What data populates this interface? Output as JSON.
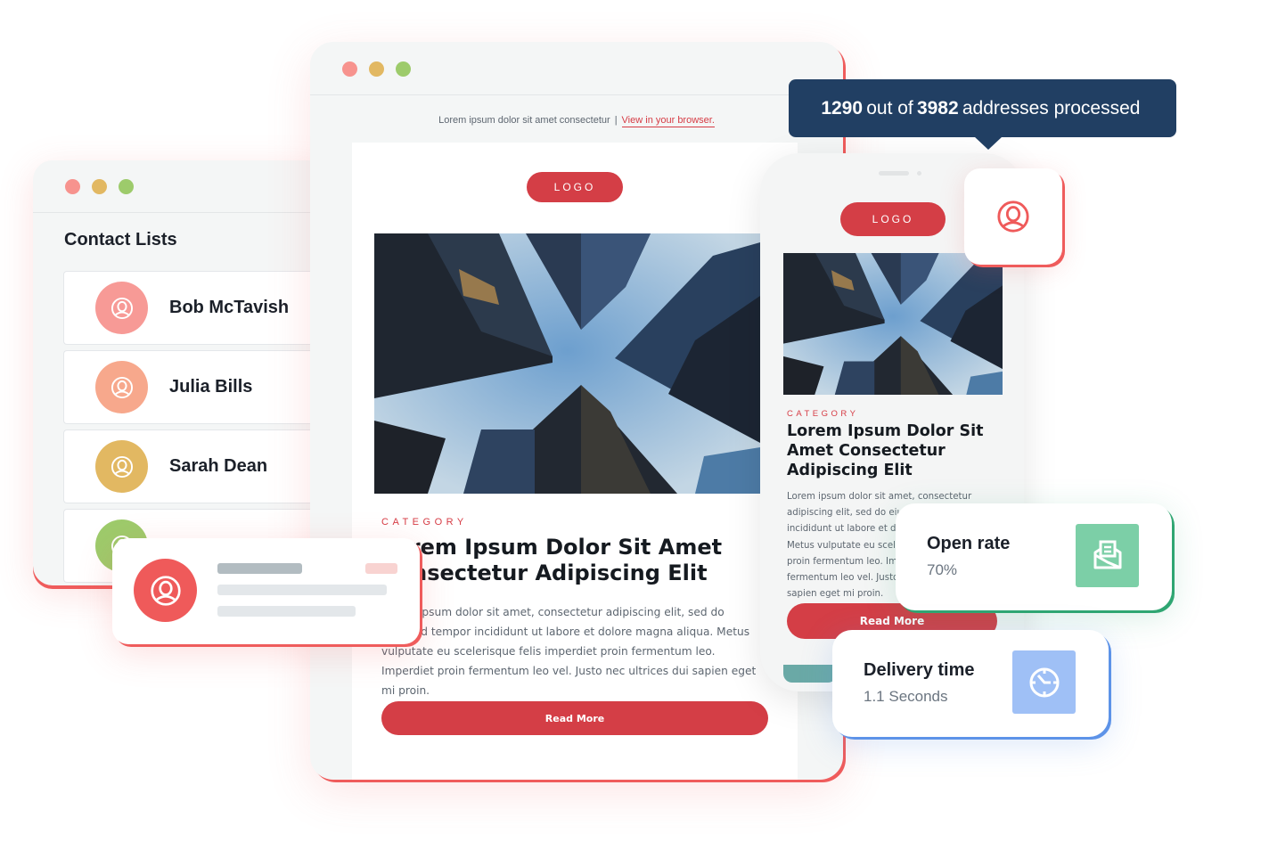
{
  "colors": {
    "accent_red": "#d43e46",
    "tooltip_navy": "#213f63",
    "open_rate_green": "#7ccfa7",
    "delivery_blue": "#9fc0f6",
    "window_dot_red": "#f7938e",
    "window_dot_yellow": "#e2b862",
    "window_dot_green": "#9dcb6b"
  },
  "contacts_window": {
    "title": "Contact Lists",
    "contacts": [
      {
        "name": "Bob McTavish",
        "avatar_color": "#f79a96",
        "icon": "user-circle-icon"
      },
      {
        "name": "Julia Bills",
        "avatar_color": "#f7a88c",
        "icon": "user-circle-icon"
      },
      {
        "name": "Sarah Dean",
        "avatar_color": "#e2b862",
        "icon": "user-circle-icon"
      },
      {
        "name": "",
        "avatar_color": "#9dcb6b",
        "icon": "user-circle-icon"
      }
    ]
  },
  "email_window": {
    "preheader_text": "Lorem ipsum dolor sit amet consectetur",
    "preheader_separator": "|",
    "view_in_browser": "View in your browser.",
    "logo_label": "LOGO",
    "category": "CATEGORY",
    "headline": "Lorem Ipsum Dolor Sit Amet Consectetur Adipiscing Elit",
    "body": "Lorem ipsum dolor sit amet, consectetur adipiscing elit, sed do eiusmod tempor incididunt ut labore et dolore magna aliqua. Metus vulputate eu scelerisque felis imperdiet proin fermentum leo. Imperdiet proin fermentum leo vel. Justo nec ultrices dui sapien eget mi proin.",
    "read_more": "Read More",
    "hero_image": "city-skyscrapers-looking-up"
  },
  "phone": {
    "logo_label": "LOGO",
    "category": "CATEGORY",
    "headline": "Lorem Ipsum Dolor Sit Amet Consectetur Adipiscing Elit",
    "body": "Lorem ipsum dolor sit amet, consectetur adipiscing elit, sed do eiusmod tempor incididunt ut labore et dolore magna aliqua. Metus vulputate eu scelerisque felis imperdiet proin fermentum leo. Imperdiet proin fermentum leo vel. Justo nec ultrices dui sapien eget mi proin.",
    "read_more": "Read More",
    "hero_image": "city-skyscrapers-looking-up"
  },
  "tooltip": {
    "processed": "1290",
    "out_of": "out of",
    "total": "3982",
    "suffix": "addresses processed"
  },
  "metrics": {
    "open_rate": {
      "label": "Open rate",
      "value": "70%",
      "icon": "open-envelope-icon"
    },
    "delivery_time": {
      "label": "Delivery time",
      "value": "1.1 Seconds",
      "icon": "clock-icon"
    }
  }
}
